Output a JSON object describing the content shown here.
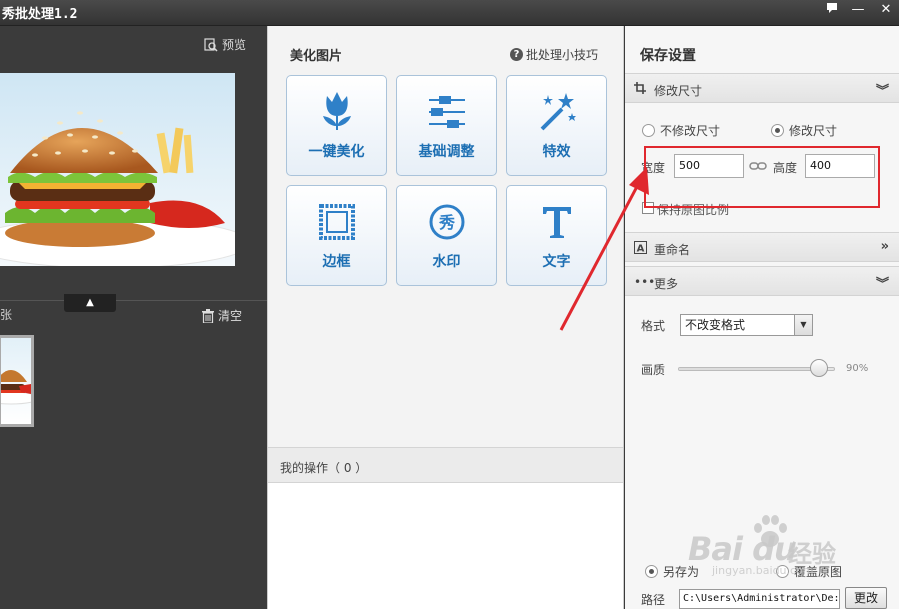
{
  "window": {
    "title": "秀批处理1.2",
    "buttons": {
      "menu": "▀",
      "minimize": "—",
      "close": "✕"
    }
  },
  "left_pane": {
    "preview_label": "预览",
    "strip_label": "张",
    "clear_label": "清空",
    "collapse_label": "▲"
  },
  "mid_pane": {
    "title": "美化图片",
    "tips_label": "批处理小技巧",
    "tools": [
      {
        "label": "一键美化",
        "icon": "tulip-icon"
      },
      {
        "label": "基础调整",
        "icon": "sliders-icon"
      },
      {
        "label": "特效",
        "icon": "magic-wand-icon"
      },
      {
        "label": "边框",
        "icon": "frame-icon"
      },
      {
        "label": "水印",
        "icon": "watermark-seal-icon"
      },
      {
        "label": "文字",
        "icon": "text-t-icon"
      }
    ],
    "ops_label": "我的操作（ 0 ）"
  },
  "right_pane": {
    "title": "保存设置",
    "resize_section": "修改尺寸",
    "no_resize_label": "不修改尺寸",
    "resize_label": "修改尺寸",
    "resize_selected": "修改尺寸",
    "width_label": "宽度",
    "width_value": "500",
    "height_label": "高度",
    "height_value": "400",
    "keep_ratio_label": "保持原图比例",
    "rename_section": "重命名",
    "more_section": "更多",
    "format_label": "格式",
    "format_value": "不改变格式",
    "quality_label": "画质",
    "quality_value": "90%",
    "quality_fraction": 0.9,
    "save_as_label": "另存为",
    "overwrite_label": "覆盖原图",
    "path_label": "路径",
    "path_value": "C:\\Users\\Administrator\\De:",
    "change_button": "更改"
  },
  "watermark": {
    "logo": "Bai du",
    "cn": "经验",
    "url": "jingyan.baidu.com"
  },
  "colors": {
    "accent_blue": "#1d6fb3",
    "highlight_red": "#e0282e"
  }
}
